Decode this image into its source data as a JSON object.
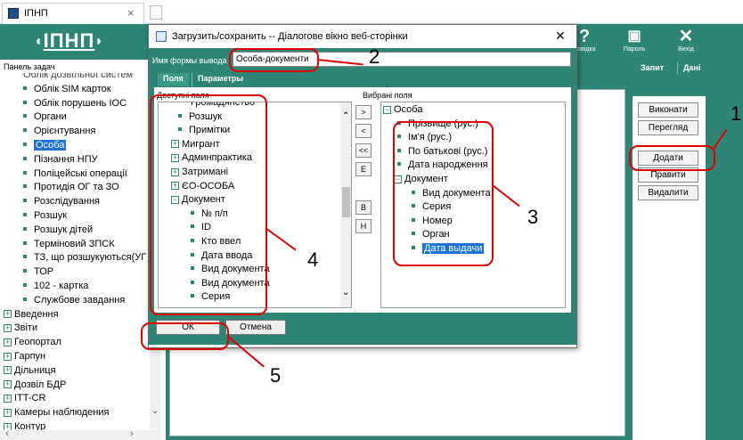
{
  "browser": {
    "tab_title": "ІПНП",
    "tab_close": "×"
  },
  "header": {
    "logo": "ІПНП",
    "buttons": [
      {
        "glyph": "?",
        "label": "Довідка"
      },
      {
        "glyph": "🔒",
        "label": "Пароль"
      },
      {
        "glyph": "✕",
        "label": "Вихід"
      }
    ]
  },
  "panel": {
    "title": "Панель задач",
    "items_flat": [
      {
        "text": "Облік дозвільної систем",
        "type": "cut"
      },
      {
        "text": "Облік SIM карток",
        "type": "bullet"
      },
      {
        "text": "Облік порушень ІОС",
        "type": "bullet"
      },
      {
        "text": "Органи",
        "type": "bullet"
      },
      {
        "text": "Орієнтування",
        "type": "bullet"
      },
      {
        "text": "Особа",
        "type": "selected"
      },
      {
        "text": "Пізнання НПУ",
        "type": "bullet"
      },
      {
        "text": "Поліцейські операції",
        "type": "bullet"
      },
      {
        "text": "Протидія ОГ та ЗО",
        "type": "bullet"
      },
      {
        "text": "Розслідування",
        "type": "bullet"
      },
      {
        "text": "Розшук",
        "type": "bullet"
      },
      {
        "text": "Розшук дітей",
        "type": "bullet"
      },
      {
        "text": "Терміновий ЗПСК",
        "type": "bullet"
      },
      {
        "text": "ТЗ, що розшукуються(УГ",
        "type": "bullet"
      },
      {
        "text": "ТОР",
        "type": "bullet"
      },
      {
        "text": "102 - картка",
        "type": "bullet"
      },
      {
        "text": "Службове завдання",
        "type": "bullet"
      },
      {
        "text": "Введення",
        "type": "group"
      },
      {
        "text": "Звіти",
        "type": "group"
      },
      {
        "text": "Геопортал",
        "type": "group"
      },
      {
        "text": "Гарпун",
        "type": "group"
      },
      {
        "text": "Дільниця",
        "type": "group"
      },
      {
        "text": "Дозвіл БДР",
        "type": "group"
      },
      {
        "text": "ITT-CR",
        "type": "group"
      },
      {
        "text": "Камеры наблюдения",
        "type": "group"
      },
      {
        "text": "Контур",
        "type": "group"
      }
    ]
  },
  "main_tabs": {
    "query": "Запит",
    "data": "Дані"
  },
  "actions": {
    "execute": "Виконати",
    "view": "Перегляд",
    "add": "Додати",
    "edit": "Правити",
    "delete": "Видалити"
  },
  "dialog": {
    "title": "Загрузить/сохранить -- Діалогове вікно веб-сторінки",
    "close": "✕",
    "form_name_label": "Имя формы вывода",
    "form_name_value": "Особа-документи",
    "tabs": {
      "fields": "Поля",
      "params": "Параметры"
    },
    "available_label": "Доступні поля",
    "chosen_label": "Вибрані поля",
    "available": [
      {
        "text": "Громадянство",
        "type": "cut"
      },
      {
        "text": "Розшук",
        "type": "bullet"
      },
      {
        "text": "Примітки",
        "type": "bullet"
      },
      {
        "text": "Мигрант",
        "type": "group"
      },
      {
        "text": "Админпрактика",
        "type": "group"
      },
      {
        "text": "Затримані",
        "type": "group"
      },
      {
        "text": "ЄО-ОСОБА",
        "type": "group"
      },
      {
        "text": "Документ",
        "type": "open"
      },
      {
        "text": "№ п/п",
        "type": "child"
      },
      {
        "text": "ID",
        "type": "child"
      },
      {
        "text": "Кто ввел",
        "type": "child"
      },
      {
        "text": "Дата ввода",
        "type": "child"
      },
      {
        "text": "Вид документа",
        "type": "child"
      },
      {
        "text": "Вид документа",
        "type": "child"
      },
      {
        "text": "Серия",
        "type": "child"
      }
    ],
    "chosen": [
      {
        "text": "Особа",
        "type": "open"
      },
      {
        "text": "Прізвище (рус.)",
        "type": "child"
      },
      {
        "text": "Ім'я (рус.)",
        "type": "child"
      },
      {
        "text": "По батькові (рус.)",
        "type": "child"
      },
      {
        "text": "Дата народження",
        "type": "child"
      },
      {
        "text": "Документ",
        "type": "open-child"
      },
      {
        "text": "Вид документа",
        "type": "grandchild"
      },
      {
        "text": "Серия",
        "type": "grandchild"
      },
      {
        "text": "Номер",
        "type": "grandchild"
      },
      {
        "text": "Орган",
        "type": "grandchild"
      },
      {
        "text": "Дата выдачи",
        "type": "grandchild-selected"
      }
    ],
    "move_buttons": [
      ">",
      "<",
      "<<",
      "E",
      "B",
      "H"
    ],
    "ok": "ОК",
    "cancel": "Отмена"
  },
  "annotations": [
    "1",
    "2",
    "3",
    "4",
    "5"
  ],
  "colors": {
    "teal": "#2e8575",
    "annotation": "#e00000",
    "selection": "#1c73d6"
  }
}
